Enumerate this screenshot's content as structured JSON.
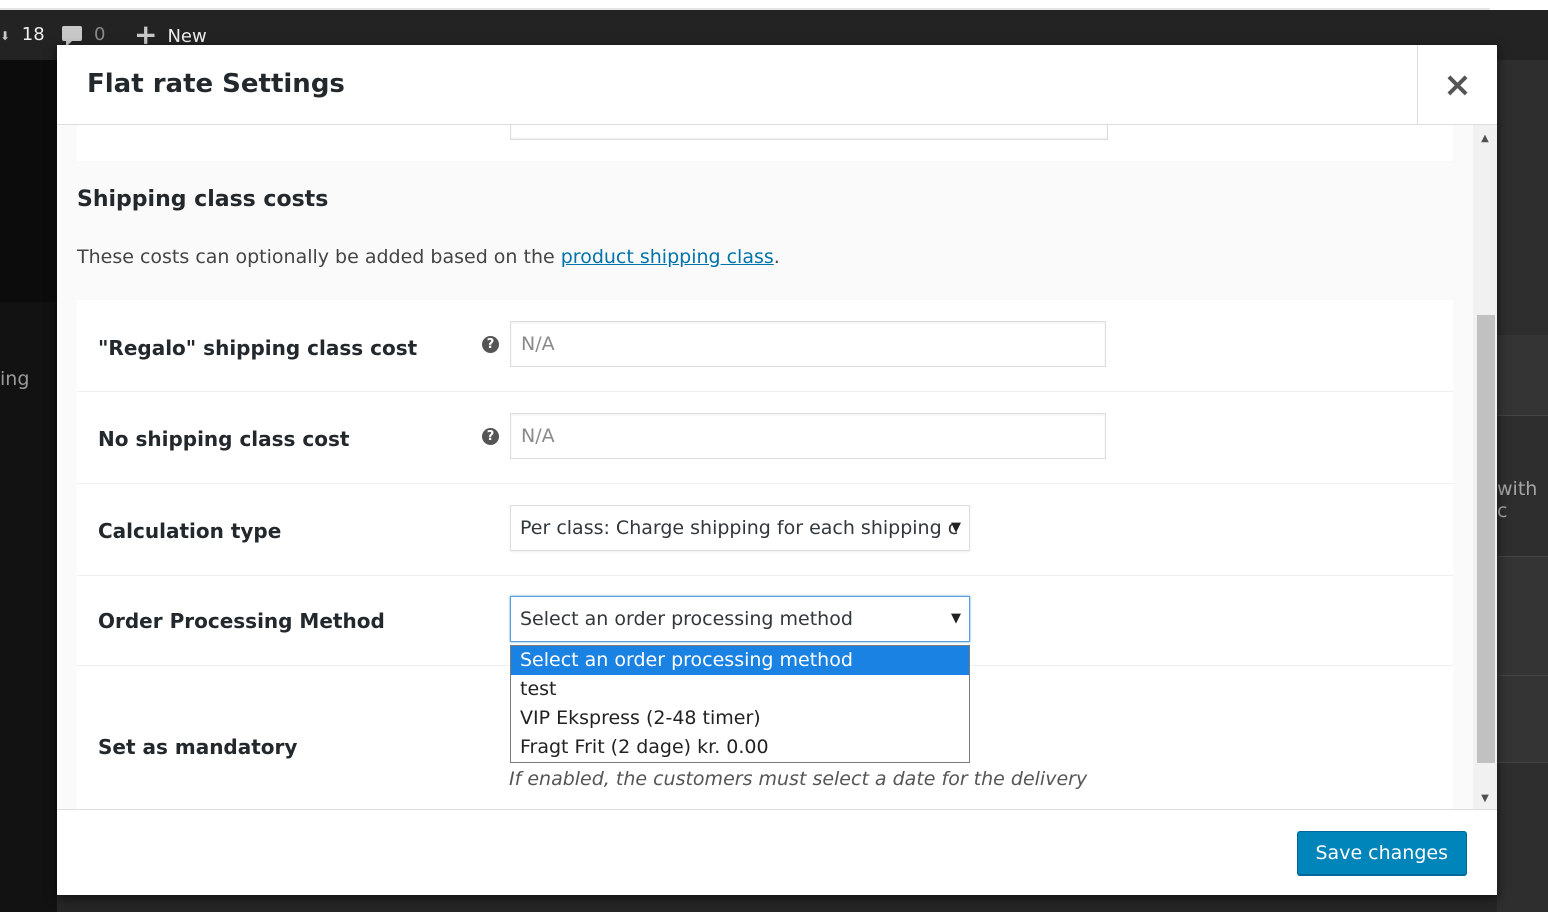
{
  "adminbar": {
    "updates_count": "18",
    "comments_count": "0",
    "new_label": "New"
  },
  "background": {
    "left_fragment": "ing",
    "right_fragment": "with c"
  },
  "modal": {
    "title": "Flat rate Settings",
    "close_label": "×"
  },
  "section": {
    "title": "Shipping class costs",
    "desc_before": "These costs can optionally be added based on the ",
    "desc_link": "product shipping class",
    "desc_after": "."
  },
  "form": {
    "regalo": {
      "label": "\"Regalo\" shipping class cost",
      "placeholder": "N/A"
    },
    "no_class": {
      "label": "No shipping class cost",
      "placeholder": "N/A"
    },
    "calc_type": {
      "label": "Calculation type",
      "value": "Per class: Charge shipping for each shipping c"
    },
    "order_processing": {
      "label": "Order Processing Method",
      "value": "Select an order processing method",
      "options": [
        "Select an order processing method",
        "test",
        "VIP Ekspress (2-48 timer)",
        "Fragt Frit (2 dage) kr. 0.00"
      ]
    },
    "mandatory": {
      "label": "Set as mandatory",
      "description": "If enabled, the customers must select a date for the delivery"
    }
  },
  "footer": {
    "save_label": "Save changes"
  },
  "icons": {
    "help": "question-circle-icon",
    "close": "close-icon",
    "dropdown": "chevron-down-icon"
  }
}
